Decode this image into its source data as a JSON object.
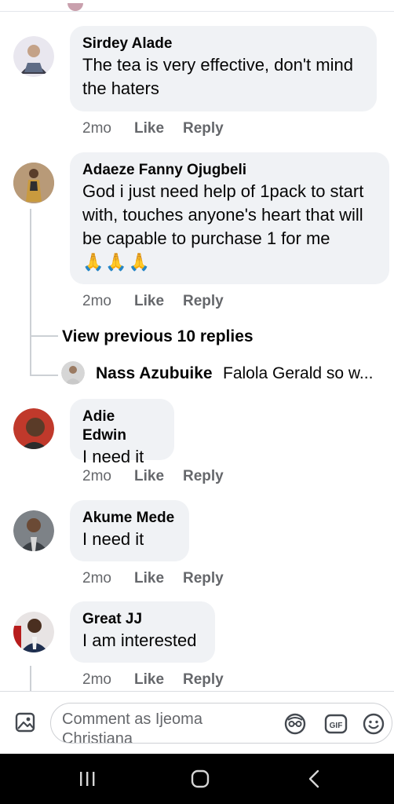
{
  "comments": [
    {
      "name": "Sirdey Alade",
      "text": "The tea is very effective, don't mind the haters",
      "time": "2mo",
      "like": "Like",
      "reply": "Reply"
    },
    {
      "name": "Adaeze Fanny Ojugbeli",
      "text": "God i just need help of 1pack to start with, touches anyone's heart that will be capable to purchase 1 for me",
      "emoji": "🙏🙏🙏",
      "time": "2mo",
      "like": "Like",
      "reply": "Reply"
    },
    {
      "name": "Adie Edwin",
      "text": "I need it",
      "time": "2mo",
      "like": "Like",
      "reply": "Reply"
    },
    {
      "name": "Akume Mede",
      "text": "I need it",
      "time": "2mo",
      "like": "Like",
      "reply": "Reply"
    },
    {
      "name": "Great JJ",
      "text": "I am interested",
      "time": "2mo",
      "like": "Like",
      "reply": "Reply"
    }
  ],
  "thread": {
    "view_previous": "View previous 10 replies",
    "reply_preview": {
      "name": "Nass Azubuike",
      "text": "Falola Gerald so w..."
    }
  },
  "composer": {
    "placeholder": "Comment as Ijeoma Christiana",
    "icons": [
      "photo-icon",
      "avatar-sticker-icon",
      "gif-icon",
      "emoji-icon"
    ]
  },
  "navigation": {
    "icons": [
      "recent-apps-icon",
      "home-icon",
      "back-icon"
    ]
  },
  "colors": {
    "bubble": "#f0f2f5",
    "meta_text": "#65676b",
    "name_text": "#050505",
    "navbar": "#000000"
  }
}
